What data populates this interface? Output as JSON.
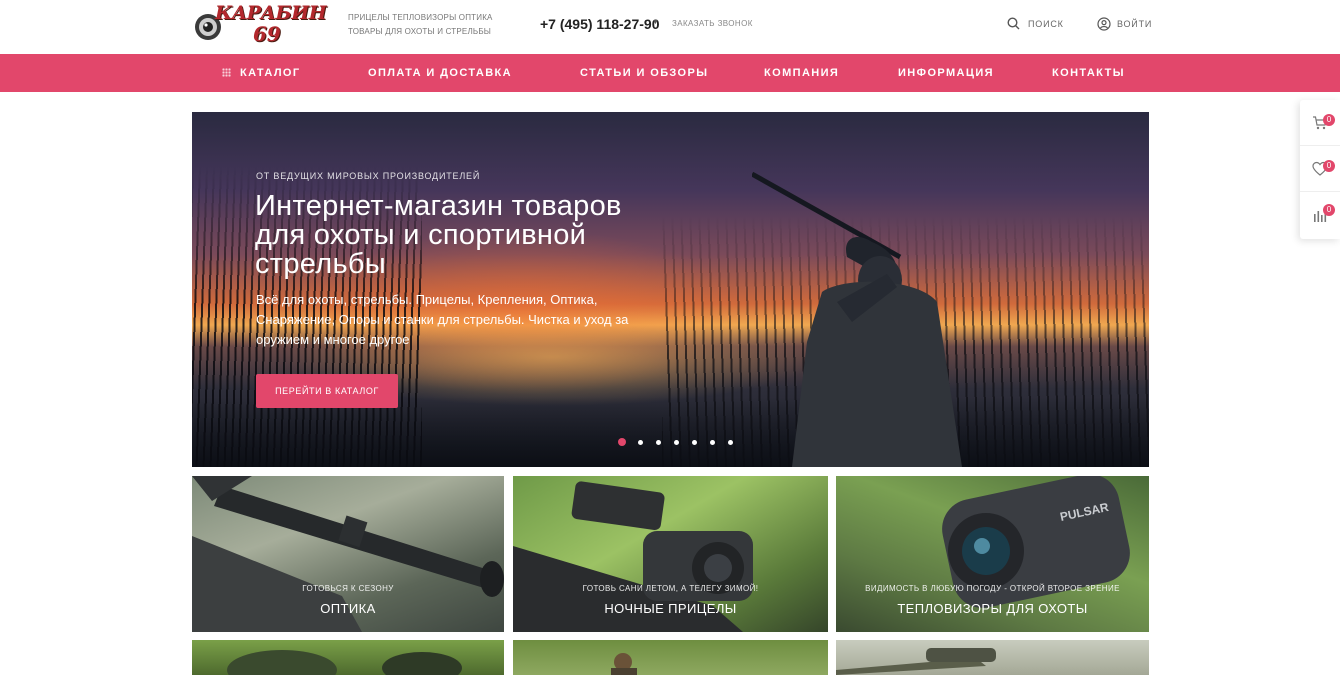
{
  "header": {
    "logo": {
      "text": "КАРАБИН",
      "number": "69"
    },
    "tagline_line1": "Прицелы тепловизоры оптика",
    "tagline_line2": "Товары для охоты и стрельбы",
    "phone": "+7 (495) 118-27-90",
    "callback_label": "Заказать звонок",
    "search_label": "Поиск",
    "login_label": "Войти"
  },
  "nav": {
    "items": [
      {
        "label": "Каталог"
      },
      {
        "label": "Оплата и доставка"
      },
      {
        "label": "Статьи и обзоры"
      },
      {
        "label": "Компания"
      },
      {
        "label": "Информация"
      },
      {
        "label": "Контакты"
      }
    ]
  },
  "hero": {
    "overline": "От ведущих мировых производителей",
    "title": "Интернет-магазин товаров для охоты и спортивной стрельбы",
    "description": "Всё для охоты, стрельбы. Прицелы, Крепления, Оптика, Снаряжение, Опоры и станки для стрельбы. Чистка и уход за оружием и многое другое",
    "button_label": "Перейти в каталог",
    "slides_total": 7,
    "active_slide": 1
  },
  "tiles": [
    {
      "subtitle": "Готовься к сезону",
      "title": "Оптика"
    },
    {
      "subtitle": "Готовь сани летом, а телегу зимой!",
      "title": "Ночные прицелы"
    },
    {
      "subtitle": "Видимость в любую погоду - открой второе зрение",
      "title": "Тепловизоры для охоты"
    }
  ],
  "side_panel": {
    "cart_count": "0",
    "favorites_count": "0",
    "compare_count": "0"
  },
  "colors": {
    "accent": "#e2476b",
    "logo_red": "#b3282d"
  }
}
